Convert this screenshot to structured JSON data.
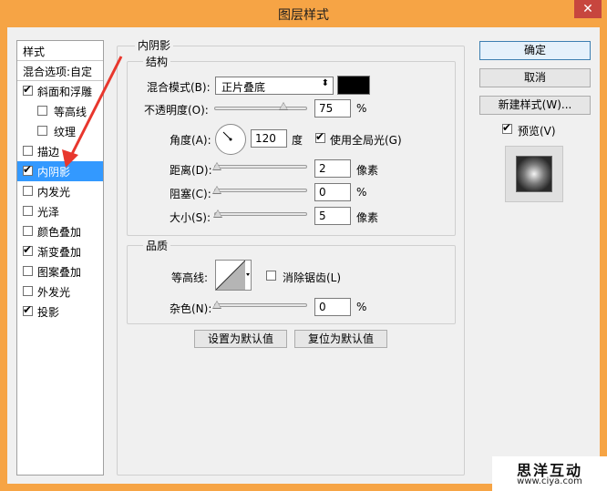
{
  "window": {
    "title": "图层样式",
    "close_glyph": "✕"
  },
  "style_list": [
    {
      "label": "样式",
      "type": "header"
    },
    {
      "label": "混合选项:自定",
      "type": "header"
    },
    {
      "label": "斜面和浮雕",
      "checked": true
    },
    {
      "label": "等高线",
      "checked": false,
      "indent": true
    },
    {
      "label": "纹理",
      "checked": false,
      "indent": true
    },
    {
      "label": "描边",
      "checked": false
    },
    {
      "label": "内阴影",
      "checked": true,
      "selected": true
    },
    {
      "label": "内发光",
      "checked": false
    },
    {
      "label": "光泽",
      "checked": false
    },
    {
      "label": "颜色叠加",
      "checked": false
    },
    {
      "label": "渐变叠加",
      "checked": true
    },
    {
      "label": "图案叠加",
      "checked": false
    },
    {
      "label": "外发光",
      "checked": false
    },
    {
      "label": "投影",
      "checked": true
    }
  ],
  "panel": {
    "title": "内阴影",
    "structure": {
      "title": "结构",
      "blend_mode_label": "混合模式(B):",
      "blend_mode_value": "正片叠底",
      "blend_color": "#000000",
      "opacity_label": "不透明度(O):",
      "opacity_value": "75",
      "opacity_unit": "%",
      "angle_label": "角度(A):",
      "angle_value": "120",
      "angle_unit": "度",
      "global_light_label": "使用全局光(G)",
      "global_light_checked": true,
      "distance_label": "距离(D):",
      "distance_value": "2",
      "distance_unit": "像素",
      "choke_label": "阻塞(C):",
      "choke_value": "0",
      "choke_unit": "%",
      "size_label": "大小(S):",
      "size_value": "5",
      "size_unit": "像素"
    },
    "quality": {
      "title": "品质",
      "contour_label": "等高线:",
      "anti_alias_label": "消除锯齿(L)",
      "anti_alias_checked": false,
      "noise_label": "杂色(N):",
      "noise_value": "0",
      "noise_unit": "%"
    },
    "make_default_label": "设置为默认值",
    "reset_default_label": "复位为默认值"
  },
  "right_buttons": {
    "ok": "确定",
    "cancel": "取消",
    "new_style": "新建样式(W)...",
    "preview_label": "预览(V)",
    "preview_checked": true
  },
  "watermark": {
    "main": "思洋互动",
    "sub": "www.ciya.com"
  },
  "colors": {
    "title_bar": "#f6a445",
    "selection": "#3399ff",
    "arrow": "#e8372d"
  }
}
